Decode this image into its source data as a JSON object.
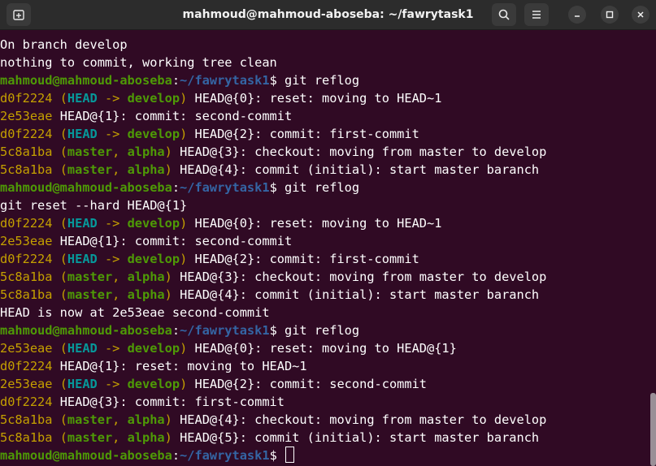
{
  "window": {
    "title": "mahmoud@mahmoud-aboseba: ~/fawrytask1"
  },
  "icons": {
    "new_tab": "new-tab-icon",
    "search": "search-icon",
    "menu": "hamburger-menu-icon",
    "minimize": "minimize-icon",
    "maximize": "maximize-icon",
    "close": "close-icon"
  },
  "colors": {
    "background": "#300a24",
    "prompt_user": "#4e9a06",
    "prompt_path": "#3465a4",
    "commit_hash": "#c4a000",
    "head_ref": "#06989a",
    "branch_ref": "#4e9a06",
    "text": "#ffffff"
  },
  "terminal": {
    "lines": [
      [
        {
          "t": "On branch develop",
          "c": "#ffffff"
        }
      ],
      [
        {
          "t": "nothing to commit, working tree clean",
          "c": "#ffffff"
        }
      ],
      [
        {
          "t": "mahmoud@mahmoud-aboseba",
          "c": "#4e9a06",
          "b": true
        },
        {
          "t": ":",
          "c": "#ffffff"
        },
        {
          "t": "~/fawrytask1",
          "c": "#3465a4",
          "b": true
        },
        {
          "t": "$ git reflog",
          "c": "#ffffff"
        }
      ],
      [
        {
          "t": "d0f2224 ",
          "c": "#c4a000"
        },
        {
          "t": "(",
          "c": "#c4a000"
        },
        {
          "t": "HEAD",
          "c": "#06989a",
          "b": true
        },
        {
          "t": " -> ",
          "c": "#c4a000"
        },
        {
          "t": "develop",
          "c": "#4e9a06",
          "b": true
        },
        {
          "t": ")",
          "c": "#c4a000"
        },
        {
          "t": " HEAD@{0}: reset: moving to HEAD~1",
          "c": "#ffffff"
        }
      ],
      [
        {
          "t": "2e53eae ",
          "c": "#c4a000"
        },
        {
          "t": "HEAD@{1}: commit: second-commit",
          "c": "#ffffff"
        }
      ],
      [
        {
          "t": "d0f2224 ",
          "c": "#c4a000"
        },
        {
          "t": "(",
          "c": "#c4a000"
        },
        {
          "t": "HEAD",
          "c": "#06989a",
          "b": true
        },
        {
          "t": " -> ",
          "c": "#c4a000"
        },
        {
          "t": "develop",
          "c": "#4e9a06",
          "b": true
        },
        {
          "t": ")",
          "c": "#c4a000"
        },
        {
          "t": " HEAD@{2}: commit: first-commit",
          "c": "#ffffff"
        }
      ],
      [
        {
          "t": "5c8a1ba ",
          "c": "#c4a000"
        },
        {
          "t": "(",
          "c": "#c4a000"
        },
        {
          "t": "master",
          "c": "#4e9a06",
          "b": true
        },
        {
          "t": ", ",
          "c": "#c4a000"
        },
        {
          "t": "alpha",
          "c": "#4e9a06",
          "b": true
        },
        {
          "t": ")",
          "c": "#c4a000"
        },
        {
          "t": " HEAD@{3}: checkout: moving from master to develop",
          "c": "#ffffff"
        }
      ],
      [
        {
          "t": "5c8a1ba ",
          "c": "#c4a000"
        },
        {
          "t": "(",
          "c": "#c4a000"
        },
        {
          "t": "master",
          "c": "#4e9a06",
          "b": true
        },
        {
          "t": ", ",
          "c": "#c4a000"
        },
        {
          "t": "alpha",
          "c": "#4e9a06",
          "b": true
        },
        {
          "t": ")",
          "c": "#c4a000"
        },
        {
          "t": " HEAD@{4}: commit (initial): start master baranch",
          "c": "#ffffff"
        }
      ],
      [
        {
          "t": "mahmoud@mahmoud-aboseba",
          "c": "#4e9a06",
          "b": true
        },
        {
          "t": ":",
          "c": "#ffffff"
        },
        {
          "t": "~/fawrytask1",
          "c": "#3465a4",
          "b": true
        },
        {
          "t": "$ git reflog",
          "c": "#ffffff"
        }
      ],
      [
        {
          "t": "git reset --hard HEAD@{1}",
          "c": "#ffffff"
        }
      ],
      [
        {
          "t": "d0f2224 ",
          "c": "#c4a000"
        },
        {
          "t": "(",
          "c": "#c4a000"
        },
        {
          "t": "HEAD",
          "c": "#06989a",
          "b": true
        },
        {
          "t": " -> ",
          "c": "#c4a000"
        },
        {
          "t": "develop",
          "c": "#4e9a06",
          "b": true
        },
        {
          "t": ")",
          "c": "#c4a000"
        },
        {
          "t": " HEAD@{0}: reset: moving to HEAD~1",
          "c": "#ffffff"
        }
      ],
      [
        {
          "t": "2e53eae ",
          "c": "#c4a000"
        },
        {
          "t": "HEAD@{1}: commit: second-commit",
          "c": "#ffffff"
        }
      ],
      [
        {
          "t": "d0f2224 ",
          "c": "#c4a000"
        },
        {
          "t": "(",
          "c": "#c4a000"
        },
        {
          "t": "HEAD",
          "c": "#06989a",
          "b": true
        },
        {
          "t": " -> ",
          "c": "#c4a000"
        },
        {
          "t": "develop",
          "c": "#4e9a06",
          "b": true
        },
        {
          "t": ")",
          "c": "#c4a000"
        },
        {
          "t": " HEAD@{2}: commit: first-commit",
          "c": "#ffffff"
        }
      ],
      [
        {
          "t": "5c8a1ba ",
          "c": "#c4a000"
        },
        {
          "t": "(",
          "c": "#c4a000"
        },
        {
          "t": "master",
          "c": "#4e9a06",
          "b": true
        },
        {
          "t": ", ",
          "c": "#c4a000"
        },
        {
          "t": "alpha",
          "c": "#4e9a06",
          "b": true
        },
        {
          "t": ")",
          "c": "#c4a000"
        },
        {
          "t": " HEAD@{3}: checkout: moving from master to develop",
          "c": "#ffffff"
        }
      ],
      [
        {
          "t": "5c8a1ba ",
          "c": "#c4a000"
        },
        {
          "t": "(",
          "c": "#c4a000"
        },
        {
          "t": "master",
          "c": "#4e9a06",
          "b": true
        },
        {
          "t": ", ",
          "c": "#c4a000"
        },
        {
          "t": "alpha",
          "c": "#4e9a06",
          "b": true
        },
        {
          "t": ")",
          "c": "#c4a000"
        },
        {
          "t": " HEAD@{4}: commit (initial): start master baranch",
          "c": "#ffffff"
        }
      ],
      [
        {
          "t": "HEAD is now at 2e53eae second-commit",
          "c": "#ffffff"
        }
      ],
      [
        {
          "t": "mahmoud@mahmoud-aboseba",
          "c": "#4e9a06",
          "b": true
        },
        {
          "t": ":",
          "c": "#ffffff"
        },
        {
          "t": "~/fawrytask1",
          "c": "#3465a4",
          "b": true
        },
        {
          "t": "$ git reflog",
          "c": "#ffffff"
        }
      ],
      [
        {
          "t": "2e53eae ",
          "c": "#c4a000"
        },
        {
          "t": "(",
          "c": "#c4a000"
        },
        {
          "t": "HEAD",
          "c": "#06989a",
          "b": true
        },
        {
          "t": " -> ",
          "c": "#c4a000"
        },
        {
          "t": "develop",
          "c": "#4e9a06",
          "b": true
        },
        {
          "t": ")",
          "c": "#c4a000"
        },
        {
          "t": " HEAD@{0}: reset: moving to HEAD@{1}",
          "c": "#ffffff"
        }
      ],
      [
        {
          "t": "d0f2224 ",
          "c": "#c4a000"
        },
        {
          "t": "HEAD@{1}: reset: moving to HEAD~1",
          "c": "#ffffff"
        }
      ],
      [
        {
          "t": "2e53eae ",
          "c": "#c4a000"
        },
        {
          "t": "(",
          "c": "#c4a000"
        },
        {
          "t": "HEAD",
          "c": "#06989a",
          "b": true
        },
        {
          "t": " -> ",
          "c": "#c4a000"
        },
        {
          "t": "develop",
          "c": "#4e9a06",
          "b": true
        },
        {
          "t": ")",
          "c": "#c4a000"
        },
        {
          "t": " HEAD@{2}: commit: second-commit",
          "c": "#ffffff"
        }
      ],
      [
        {
          "t": "d0f2224 ",
          "c": "#c4a000"
        },
        {
          "t": "HEAD@{3}: commit: first-commit",
          "c": "#ffffff"
        }
      ],
      [
        {
          "t": "5c8a1ba ",
          "c": "#c4a000"
        },
        {
          "t": "(",
          "c": "#c4a000"
        },
        {
          "t": "master",
          "c": "#4e9a06",
          "b": true
        },
        {
          "t": ", ",
          "c": "#c4a000"
        },
        {
          "t": "alpha",
          "c": "#4e9a06",
          "b": true
        },
        {
          "t": ")",
          "c": "#c4a000"
        },
        {
          "t": " HEAD@{4}: checkout: moving from master to develop",
          "c": "#ffffff"
        }
      ],
      [
        {
          "t": "5c8a1ba ",
          "c": "#c4a000"
        },
        {
          "t": "(",
          "c": "#c4a000"
        },
        {
          "t": "master",
          "c": "#4e9a06",
          "b": true
        },
        {
          "t": ", ",
          "c": "#c4a000"
        },
        {
          "t": "alpha",
          "c": "#4e9a06",
          "b": true
        },
        {
          "t": ")",
          "c": "#c4a000"
        },
        {
          "t": " HEAD@{5}: commit (initial): start master baranch",
          "c": "#ffffff"
        }
      ],
      [
        {
          "t": "mahmoud@mahmoud-aboseba",
          "c": "#4e9a06",
          "b": true
        },
        {
          "t": ":",
          "c": "#ffffff"
        },
        {
          "t": "~/fawrytask1",
          "c": "#3465a4",
          "b": true
        },
        {
          "t": "$ ",
          "c": "#ffffff"
        }
      ]
    ]
  }
}
